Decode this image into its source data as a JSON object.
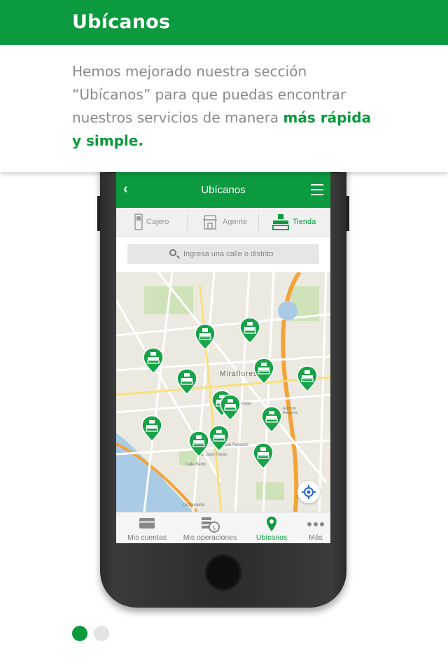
{
  "header": {
    "title": "Ubícanos"
  },
  "intro": {
    "text_plain": "Hemos mejorado nuestra sección “Ubícanos” para que puedas encontrar nuestros servicios de manera ",
    "text_highlight": "más rápida y simple."
  },
  "app": {
    "back_icon": "chevron-left-icon",
    "title": "Ubícanos",
    "list_icon": "list-view-icon",
    "tabs": [
      {
        "label": "Cajero",
        "icon": "atm-icon",
        "active": false
      },
      {
        "label": "Agente",
        "icon": "store-icon",
        "active": false
      },
      {
        "label": "Tienda",
        "icon": "bank-counter-icon",
        "active": true
      }
    ],
    "search": {
      "placeholder": "Ingresa una calle o distrito",
      "icon": "search-icon"
    },
    "map_labels": [
      "Miraflores",
      "Calle Chiclayo",
      "Av. Jose Pardo",
      "Calle Berlin",
      "La Pampilla",
      "Estación Angamos",
      "Parque Palacios"
    ],
    "bottom_nav": [
      {
        "label": "Mis cuentas",
        "icon": "card-icon",
        "active": false
      },
      {
        "label": "Mis operaciones",
        "icon": "coins-icon",
        "active": false
      },
      {
        "label": "Ubícanos",
        "icon": "location-pin-icon",
        "active": true
      },
      {
        "label": "Más",
        "icon": "more-dots-icon",
        "active": false
      }
    ]
  },
  "colors": {
    "brand_green": "#0b9a3e",
    "intro_text": "#8a8a8a",
    "dot_inactive": "#e3e3e3"
  },
  "pager": {
    "current_page": 1,
    "total_pages": 2
  }
}
